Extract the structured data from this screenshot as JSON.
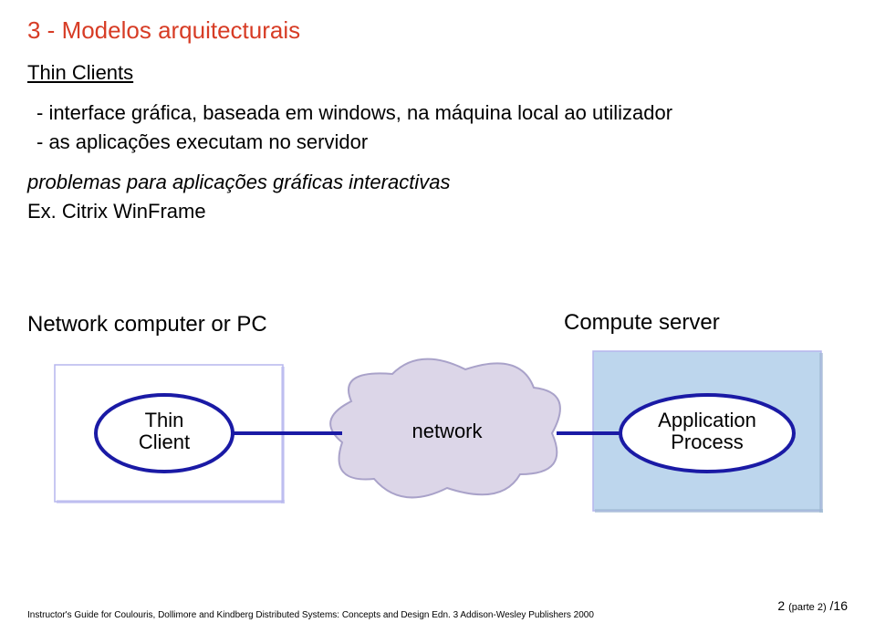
{
  "title": "3  - Modelos arquitecturais",
  "subheading": "Thin Clients",
  "bullet1": "- interface gráfica, baseada em windows, na máquina local ao utilizador",
  "bullet2": "- as aplicações executam no servidor",
  "problems": "problemas para aplicações gráficas interactivas",
  "example": "Ex. Citrix WinFrame",
  "diagram": {
    "pc_label": "Network computer or PC",
    "server_label": "Compute server",
    "thin": "Thin",
    "client": "Client",
    "network": "network",
    "application": "Application",
    "process": "Process"
  },
  "footer": "Instructor's Guide for  Coulouris, Dollimore and Kindberg   Distributed Systems: Concepts and Design   Edn. 3    Addison-Wesley Publishers 2000",
  "page": {
    "prefix": "2 ",
    "mid": "(parte 2)",
    "suffix": " /16"
  }
}
